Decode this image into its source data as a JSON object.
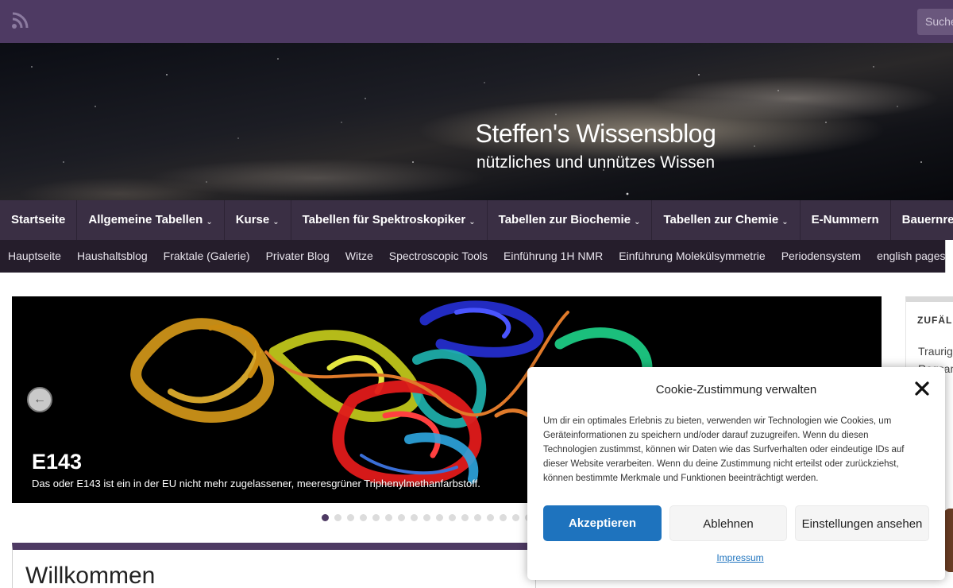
{
  "topbar": {
    "rss_icon": "rss-icon",
    "search_placeholder": "Suche..."
  },
  "header": {
    "title": "Steffen's Wissensblog",
    "subtitle": "nützliches und unnützes Wissen"
  },
  "main_nav": {
    "items": [
      {
        "label": "Startseite",
        "dropdown": false
      },
      {
        "label": "Allgemeine Tabellen",
        "dropdown": true
      },
      {
        "label": "Kurse",
        "dropdown": true
      },
      {
        "label": "Tabellen für Spektroskopiker",
        "dropdown": true
      },
      {
        "label": "Tabellen zur Biochemie",
        "dropdown": true
      },
      {
        "label": "Tabellen zur Chemie",
        "dropdown": true
      },
      {
        "label": "E-Nummern",
        "dropdown": false
      },
      {
        "label": "Bauernregeln",
        "dropdown": false
      }
    ],
    "chevron": "⌄"
  },
  "sub_nav": {
    "items": [
      "Hauptseite",
      "Haushaltsblog",
      "Fraktale (Galerie)",
      "Privater Blog",
      "Witze",
      "Spectroscopic Tools",
      "Einführung 1H NMR",
      "Einführung Molekülsymmetrie",
      "Periodensystem",
      "english pages"
    ]
  },
  "slider": {
    "prev_icon": "←",
    "title": "E143",
    "description": "Das oder E143 ist ein in der EU nicht mehr zugelassener, meeresgrüner Triphenylmethanfarbstoff.",
    "dot_count": 17,
    "active_index": 0
  },
  "welcome": {
    "heading": "Willkommen"
  },
  "sidebar": {
    "widget_label": "ZUFÄLLIGE",
    "line1": "Traurig",
    "line2": "Regsam"
  },
  "cookie": {
    "title": "Cookie-Zustimmung verwalten",
    "close_icon": "close-icon",
    "text": "Um dir ein optimales Erlebnis zu bieten, verwenden wir Technologien wie Cookies, um Geräteinformationen zu speichern und/oder darauf zuzugreifen. Wenn du diesen Technologien zustimmst, können wir Daten wie das Surfverhalten oder eindeutige IDs auf dieser Website verarbeiten. Wenn du deine Zustimmung nicht erteilst oder zurückziehst, können bestimmte Merkmale und Funktionen beeinträchtigt werden.",
    "accept": "Akzeptieren",
    "deny": "Ablehnen",
    "settings": "Einstellungen ansehen",
    "impressum": "Impressum"
  },
  "colors": {
    "brand": "#4e3a63",
    "nav": "#3a2f44",
    "subnav": "#251d2b",
    "accept": "#1e73be"
  }
}
